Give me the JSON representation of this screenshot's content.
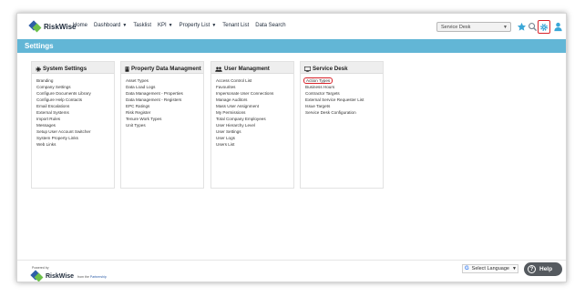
{
  "app": {
    "logo_text": "RiskWise"
  },
  "nav": {
    "items": [
      {
        "label": "Home",
        "dropdown": false
      },
      {
        "label": "Dashboard",
        "dropdown": true
      },
      {
        "label": "Tasklist",
        "dropdown": false
      },
      {
        "label": "KPI",
        "dropdown": true
      },
      {
        "label": "Property List",
        "dropdown": true
      },
      {
        "label": "Tenant List",
        "dropdown": false
      },
      {
        "label": "Data Search",
        "dropdown": false
      }
    ]
  },
  "header": {
    "module_select": "Service Desk",
    "icons": [
      "star-icon",
      "search-icon",
      "gear-icon",
      "user-icon"
    ]
  },
  "banner": {
    "title": "Settings"
  },
  "cards": [
    {
      "title": "System Settings",
      "icon": "gear-icon",
      "items": [
        "Branding",
        "Company Settings",
        "Configure Documents Library",
        "Configure Help Contacts",
        "Email Escalations",
        "External Systems",
        "Import Rules",
        "Messages",
        "Setup User Account Switcher",
        "System Property Links",
        "Web Links"
      ]
    },
    {
      "title": "Property Data Managment",
      "icon": "building-icon",
      "items": [
        "Asset Types",
        "Data Load Logs",
        "Data Management - Properties",
        "Data Management - Registers",
        "EPC Ratings",
        "Risk Register",
        "Tenure Work Types",
        "Unit Types"
      ]
    },
    {
      "title": "User Managment",
      "icon": "users-icon",
      "items": [
        "Access Control List",
        "Favourites",
        "Impersonate User Connections",
        "Manage Auditors",
        "Mass User Assignment",
        "My Permissions",
        "Total Company Employees",
        "User Hierarchy Level",
        "User Settings",
        "User Logs",
        "Users List"
      ]
    },
    {
      "title": "Service Desk",
      "icon": "monitor-icon",
      "items": [
        "Action Types",
        "Business Hours",
        "Contractor Targets",
        "External Service Requester List",
        "Issue Targets",
        "Service Desk Configuration"
      ]
    }
  ],
  "footer": {
    "powered_by": "Powered by",
    "logo_text": "RiskWise",
    "partner_prefix": "from the",
    "partner_name": "Partnership",
    "translate_label": "Select Language",
    "translate_google": "G",
    "help_label": "Help"
  },
  "colors": {
    "banner": "#62b6d6",
    "highlight": "#d8232a",
    "accent_icon": "#3aa7d8"
  }
}
